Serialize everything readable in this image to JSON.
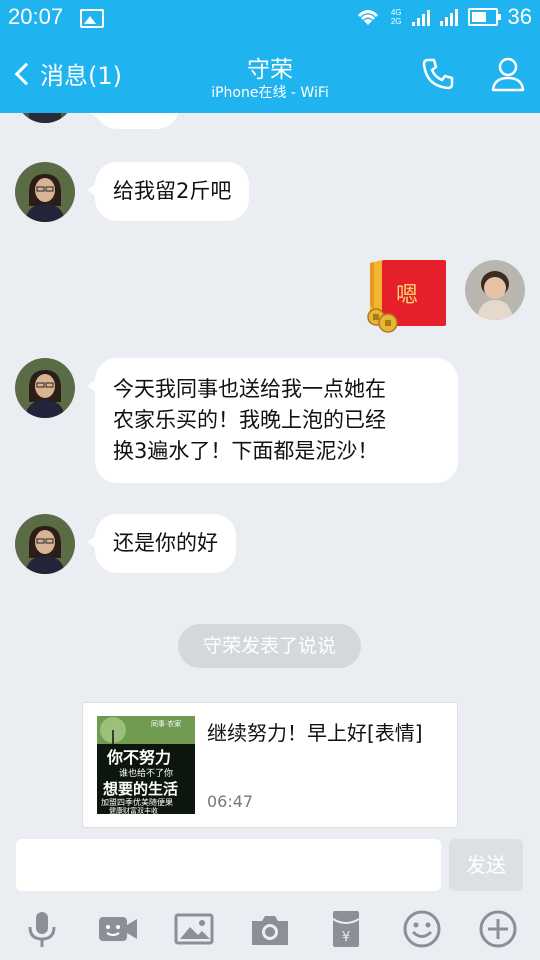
{
  "status_bar": {
    "time": "20:07",
    "net_top": "4G",
    "net_bottom": "2G",
    "battery": "36"
  },
  "header": {
    "back_label": "消息(1)",
    "title": "守荣",
    "subtitle": "iPhone在线 - WiFi"
  },
  "messages": [
    {
      "side": "left",
      "text": "给我留2斤吧"
    },
    {
      "side": "right",
      "type": "red-packet",
      "text": "嗯"
    },
    {
      "side": "left",
      "lines": [
        "今天我同事也送给我一点她在",
        "农家乐买的！我晚上泡的已经",
        "换3遍水了！下面都是泥沙！"
      ]
    },
    {
      "side": "left",
      "text": "还是你的好"
    }
  ],
  "system_notice": "守荣发表了说说",
  "share_card": {
    "text": "继续努力！早上好[表情]",
    "time": "06:47",
    "thumb": {
      "brand": "同事·农家",
      "line1": "你不努力",
      "line2": "谁也给不了你",
      "line3": "想要的生活",
      "line4": "加盟四季优美随便果",
      "line5": "健康财富双丰收"
    }
  },
  "composer": {
    "placeholder": "",
    "send_label": "发送"
  },
  "toolbar_icons": [
    "mic-icon",
    "video-icon",
    "image-icon",
    "camera-icon",
    "red-packet-icon",
    "emoji-icon",
    "plus-icon"
  ],
  "colors": {
    "accent": "#1fb4f0",
    "background": "#eaedf2",
    "red_packet": "#e5202a"
  }
}
